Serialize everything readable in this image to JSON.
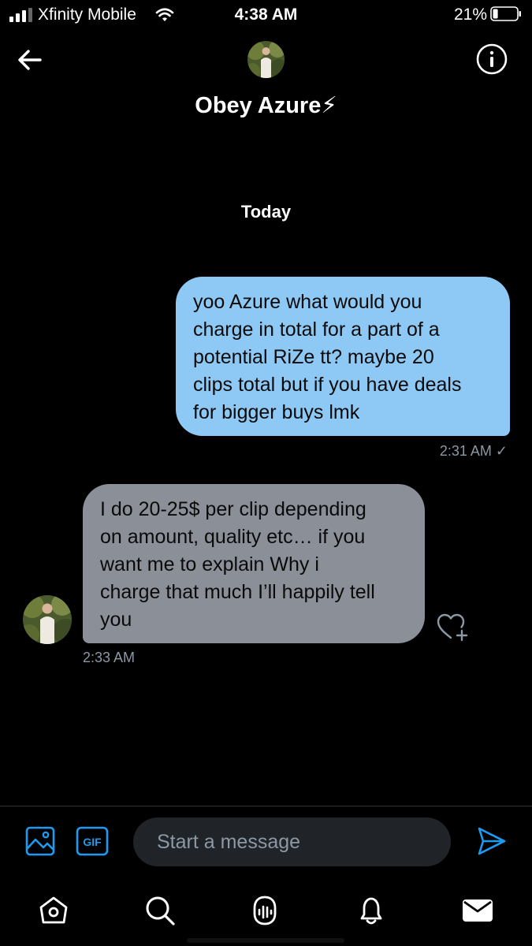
{
  "status_bar": {
    "carrier": "Xfinity Mobile",
    "time": "4:38 AM",
    "battery_percent": "21%",
    "battery_level": 0.21
  },
  "header": {
    "contact_name": "Obey Azure⚡",
    "back_icon": "back-arrow-icon",
    "info_icon": "info-icon"
  },
  "conversation": {
    "date_separator": "Today",
    "messages": [
      {
        "direction": "outgoing",
        "lines": [
          "yoo Azure what would you",
          "charge in total for a part of a",
          "potential RiZe tt? maybe 20",
          "clips total but if you have deals",
          "for bigger buys lmk"
        ],
        "time": "2:31 AM ✓",
        "bubble_color": "#8ec9f5"
      },
      {
        "direction": "incoming",
        "lines": [
          "I do 20-25$ per clip depending",
          "on amount, quality etc… if you",
          "want me to explain Why i",
          "charge that much I’ll happily tell",
          "you"
        ],
        "time": "2:33 AM",
        "bubble_color": "#8a8f98"
      }
    ]
  },
  "composer": {
    "placeholder": "Start a message",
    "gif_label": "GIF",
    "accent_color": "#1d9bf0"
  },
  "tab_bar": {
    "items": [
      "home-icon",
      "search-icon",
      "spaces-icon",
      "notifications-icon",
      "messages-icon"
    ]
  }
}
